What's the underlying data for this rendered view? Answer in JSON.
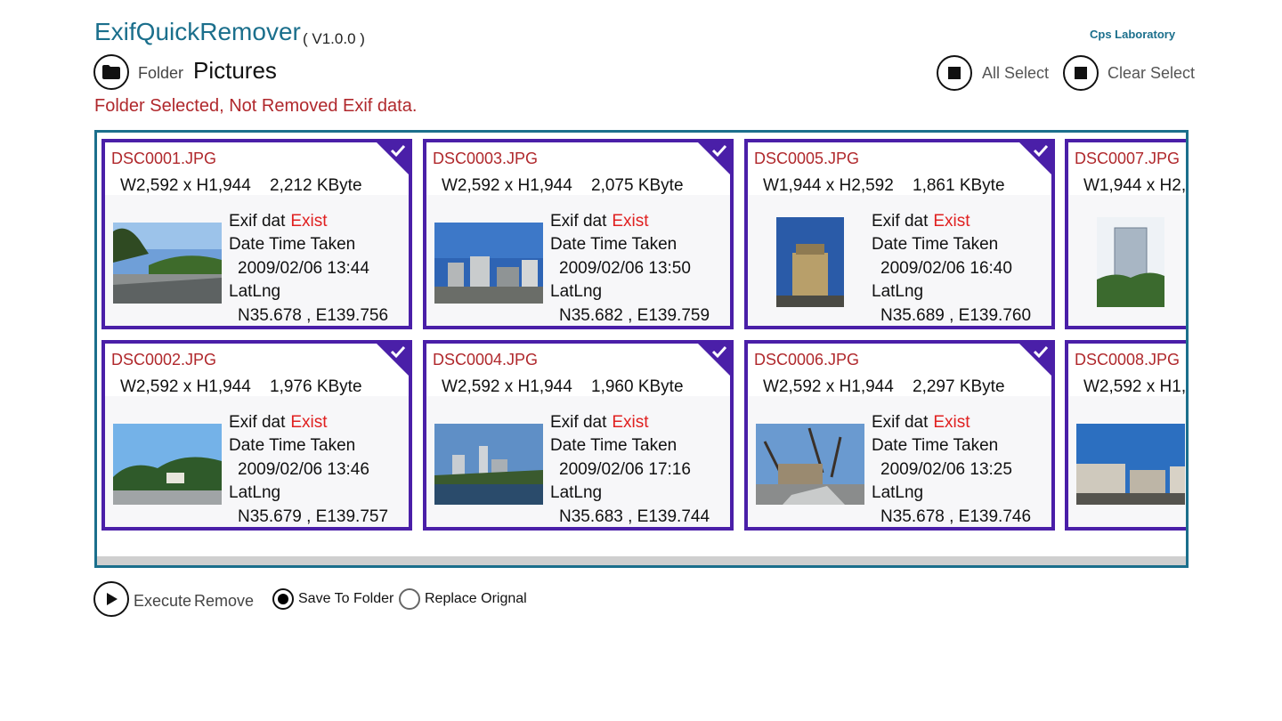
{
  "header": {
    "app_title": "ExifQuickRemover",
    "version": "( V1.0.0 )",
    "vendor": "Cps Laboratory"
  },
  "toolbar": {
    "folder_icon": "folder-icon",
    "folder_label": "Folder",
    "folder_name": "Pictures",
    "all_select_label": "All Select",
    "clear_select_label": "Clear Select",
    "stop_icon": "stop-square-icon"
  },
  "status": "Folder Selected, Not Removed Exif data.",
  "colors": {
    "accent": "#1b6f8c",
    "card_border": "#4a1fa8",
    "filename": "#b0282c",
    "exist": "#e02020"
  },
  "info_labels": {
    "exif": "Exif dat",
    "date": "Date Time Taken",
    "latlng": "LatLng"
  },
  "photos": [
    {
      "name": "DSC0001.JPG",
      "dims": "W2,592 x H1,944",
      "size": "2,212 KByte",
      "exif": "Exist",
      "date": "2009/02/06 13:44",
      "latlng": "N35.678 , E139.756",
      "selected": true
    },
    {
      "name": "DSC0002.JPG",
      "dims": "W2,592 x H1,944",
      "size": "1,976 KByte",
      "exif": "Exist",
      "date": "2009/02/06 13:46",
      "latlng": "N35.679 , E139.757",
      "selected": true
    },
    {
      "name": "DSC0003.JPG",
      "dims": "W2,592 x H1,944",
      "size": "2,075 KByte",
      "exif": "Exist",
      "date": "2009/02/06 13:50",
      "latlng": "N35.682 , E139.759",
      "selected": true
    },
    {
      "name": "DSC0004.JPG",
      "dims": "W2,592 x H1,944",
      "size": "1,960 KByte",
      "exif": "Exist",
      "date": "2009/02/06 17:16",
      "latlng": "N35.683 , E139.744",
      "selected": true
    },
    {
      "name": "DSC0005.JPG",
      "dims": "W1,944 x H2,592",
      "size": "1,861 KByte",
      "exif": "Exist",
      "date": "2009/02/06 16:40",
      "latlng": "N35.689 , E139.760",
      "selected": true
    },
    {
      "name": "DSC0006.JPG",
      "dims": "W2,592 x H1,944",
      "size": "2,297 KByte",
      "exif": "Exist",
      "date": "2009/02/06 13:25",
      "latlng": "N35.678 , E139.746",
      "selected": true
    },
    {
      "name": "DSC0007.JPG",
      "dims": "W1,944 x H2,",
      "size": "",
      "exif": "",
      "date": "",
      "latlng": "",
      "selected": true
    },
    {
      "name": "DSC0008.JPG",
      "dims": "W2,592 x H1,",
      "size": "",
      "exif": "",
      "date": "",
      "latlng": "",
      "selected": true
    }
  ],
  "bottom": {
    "execute_label": "Execute",
    "remove_label": "Remove",
    "play_icon": "play-icon",
    "save_to_folder_label": "Save To Folder",
    "replace_original_label": "Replace Orignal",
    "selected_option": "Save To Folder"
  }
}
